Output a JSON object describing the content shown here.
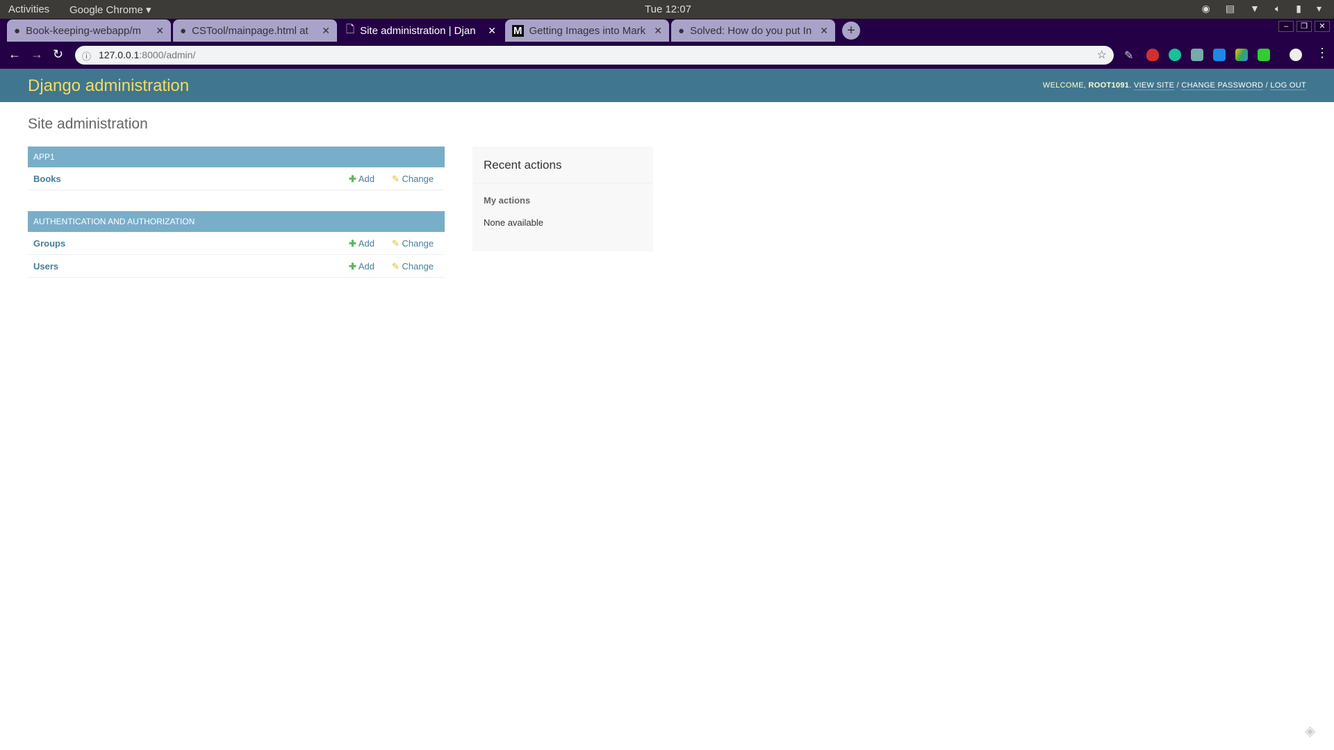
{
  "os": {
    "activities": "Activities",
    "app": "Google Chrome",
    "clock": "Tue 12:07"
  },
  "browser": {
    "tabs": [
      {
        "title": "Book-keeping-webapp/m",
        "icon": "github-icon"
      },
      {
        "title": "CSTool/mainpage.html at",
        "icon": "github-icon"
      },
      {
        "title": "Site administration | Djan",
        "icon": "page-icon",
        "active": true
      },
      {
        "title": "Getting Images into Mark",
        "icon": "medium-icon"
      },
      {
        "title": "Solved: How do you put In",
        "icon": "github-icon"
      }
    ],
    "url_host": "127.0.0.1",
    "url_rest": ":8000/admin/"
  },
  "header": {
    "brand": "Django administration",
    "welcome": "Welcome,",
    "user": "ROOT1091",
    "view_site": "View site",
    "change_password": "Change password",
    "log_out": "Log out"
  },
  "page_title": "Site administration",
  "modules": [
    {
      "caption": "APP1",
      "rows": [
        {
          "name": "Books",
          "add": "Add",
          "change": "Change"
        }
      ]
    },
    {
      "caption": "Authentication and Authorization",
      "rows": [
        {
          "name": "Groups",
          "add": "Add",
          "change": "Change"
        },
        {
          "name": "Users",
          "add": "Add",
          "change": "Change"
        }
      ]
    }
  ],
  "recent": {
    "title": "Recent actions",
    "subtitle": "My actions",
    "empty": "None available"
  },
  "colors": {
    "header": "#417690",
    "brand": "#f5dd5d",
    "caption": "#79aec8",
    "link": "#447e9b"
  }
}
